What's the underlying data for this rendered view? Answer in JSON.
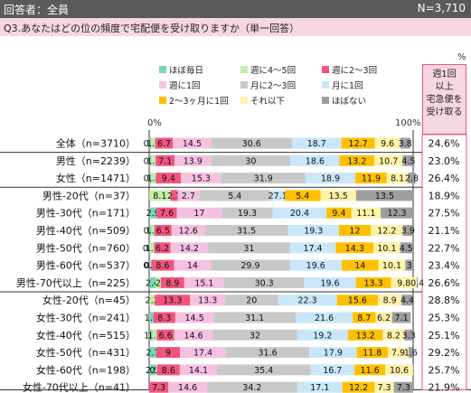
{
  "header": {
    "respondents_label": "回答者：全員",
    "n_total": "N=3,710"
  },
  "question": "Q3.あなたはどの位の頻度で宅配便を受け取りますか（単一回答）",
  "right_column_header": "週1回\n以上\n宅急便を\n受け取る",
  "colors": {
    "ほぼ毎日": "#77d6b8",
    "週に4～5回": "#c3eda9",
    "週に2～3回": "#f2547e",
    "週に1回": "#f6c1e1",
    "月に2～3回": "#c8c8c8",
    "月に1回": "#c9e6fa",
    "2～3ヶ月に1回": "#ffc000",
    "それ以下": "#fff2a8",
    "ほぼない": "#9e9e9e"
  },
  "chart_data": {
    "type": "bar",
    "stacked": true,
    "orientation": "horizontal",
    "percent_unit": "%",
    "axis_min_label": "0%",
    "axis_max_label": "100%",
    "legend_position": "top",
    "series": [
      {
        "name": "ほぼ毎日"
      },
      {
        "name": "週に4～5回"
      },
      {
        "name": "週に2～3回"
      },
      {
        "name": "週に1回"
      },
      {
        "name": "月に2～3回"
      },
      {
        "name": "月に1回"
      },
      {
        "name": "2～3ヶ月に1回"
      },
      {
        "name": "それ以下"
      },
      {
        "name": "ほぼない"
      }
    ],
    "rows": [
      {
        "label": "全体（n=3710）",
        "values": [
          0.8,
          1.5,
          6.7,
          14.5,
          30.6,
          18.7,
          12.7,
          9.6,
          3.8
        ],
        "total": "24.6%",
        "group": 0
      },
      {
        "label": "男性（n=2239）",
        "values": [
          0.8,
          1.7,
          7.1,
          13.9,
          30.0,
          18.6,
          13.2,
          10.7,
          4.5
        ],
        "total": "23.0%",
        "group": 1
      },
      {
        "label": "女性（n=1471）",
        "values": [
          0.8,
          1.8,
          9.4,
          15.3,
          31.9,
          18.9,
          11.9,
          8.1,
          2.8
        ],
        "total": "26.4%",
        "group": 1
      },
      {
        "label": "男性-20代（n=37）",
        "values": [
          0,
          8.1,
          2.7,
          8.1,
          27.1,
          5.4,
          13.5,
          13.5,
          21.6
        ],
        "total": "18.9%",
        "group": 2,
        "shown": [
          "",
          "8.1",
          "2.7",
          "2.7",
          "5.4",
          "27.1",
          "5.4",
          "13.5",
          "13.5",
          "21.6"
        ]
      },
      {
        "label": "男性-30代（n=171）",
        "values": [
          2.9,
          0,
          7.6,
          17.0,
          19.3,
          20.4,
          9.4,
          11.1,
          12.3
        ],
        "total": "27.5%",
        "group": 2
      },
      {
        "label": "男性-40代（n=509）",
        "values": [
          0.8,
          1.2,
          6.5,
          12.6,
          31.5,
          19.3,
          12.0,
          12.2,
          3.9
        ],
        "total": "21.1%",
        "group": 2
      },
      {
        "label": "男性-50代（n=760）",
        "values": [
          0.3,
          1.6,
          6.2,
          14.2,
          31.0,
          17.4,
          14.3,
          10.1,
          4.5
        ],
        "total": "22.7%",
        "group": 2
      },
      {
        "label": "男性-60代（n=537）",
        "values": [
          0.6,
          0.2,
          8.6,
          14.0,
          29.9,
          19.6,
          14.0,
          10.1,
          3.0
        ],
        "total": "23.4%",
        "group": 2
      },
      {
        "label": "男性-70代以上（n=225）",
        "values": [
          2.4,
          2.0,
          8.9,
          15.1,
          30.3,
          19.6,
          13.3,
          9.8,
          0.4
        ],
        "total": "26.6%",
        "group": 2
      },
      {
        "label": "女性-20代（n=45）",
        "values": [
          0,
          2.2,
          13.3,
          13.3,
          20.0,
          22.3,
          15.6,
          8.9,
          4.4
        ],
        "total": "28.8%",
        "group": 3
      },
      {
        "label": "女性-30代（n=241）",
        "values": [
          1.6,
          0,
          8.3,
          14.5,
          31.1,
          21.6,
          8.7,
          6.2,
          7.1
        ],
        "total": "25.3%",
        "group": 3
      },
      {
        "label": "女性-40代（n=515）",
        "values": [
          1.2,
          1.7,
          6.6,
          14.6,
          32.0,
          19.2,
          13.2,
          8.2,
          3.3
        ],
        "total": "25.1%",
        "group": 3
      },
      {
        "label": "女性-50代（n=431）",
        "values": [
          2.7,
          0,
          9.0,
          17.4,
          31.6,
          17.9,
          11.8,
          7.9,
          1.6
        ],
        "total": "29.2%",
        "group": 3
      },
      {
        "label": "女性-60代（n=198）",
        "values": [
          2.5,
          0.5,
          8.6,
          14.1,
          35.4,
          16.7,
          11.6,
          10.6,
          0
        ],
        "total": "25.7%",
        "group": 3
      },
      {
        "label": "女性-70代以上（n=41）",
        "values": [
          0,
          0,
          7.3,
          14.6,
          34.2,
          17.1,
          12.2,
          7.3,
          7.3
        ],
        "total": "21.9%",
        "group": 3
      }
    ]
  }
}
